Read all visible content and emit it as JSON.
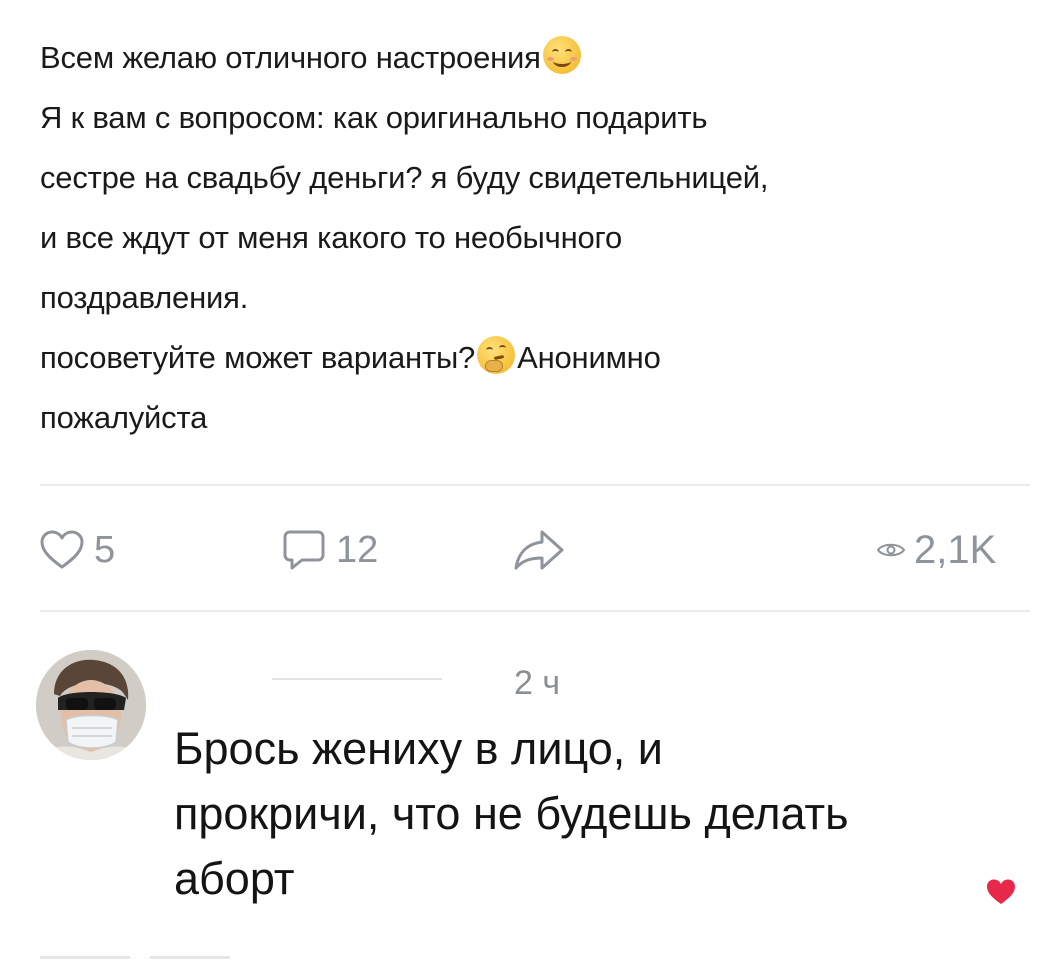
{
  "post": {
    "lines": [
      {
        "text": "Всем желаю отличного настроения",
        "emoji": "smiling-face-icon"
      },
      {
        "text": "Я к вам с вопросом: как оригинально подарить"
      },
      {
        "text": "сестре на свадьбу деньги? я буду свидетельницей,"
      },
      {
        "text": "и все ждут от меня какого то необычного"
      },
      {
        "text": "поздравления."
      },
      {
        "text": "посоветуйте может варианты?",
        "emoji": "thinking-face-icon",
        "after": "Анонимно"
      },
      {
        "text": "пожалуйста"
      }
    ]
  },
  "actions": {
    "likes": "5",
    "comments": "12",
    "views": "2,1K"
  },
  "comment": {
    "time": "2 ч",
    "lines": [
      "Брось жениху в лицо, и",
      "прокричи, что не будешь делать",
      "аборт"
    ],
    "liked_color": "#e6294b"
  },
  "icons": {
    "like": "heart-outline-icon",
    "comment": "comment-bubble-icon",
    "share": "share-arrow-icon",
    "views": "eye-icon",
    "comment_like": "heart-filled-icon"
  },
  "colors": {
    "icon_gray": "#8e949a",
    "text": "#1a1a1a"
  }
}
